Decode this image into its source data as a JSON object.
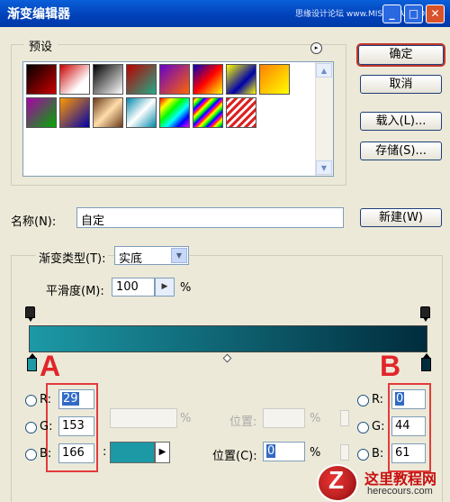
{
  "window": {
    "title": "渐变编辑器",
    "watermark": "思缘设计论坛 www.MISSYUAN.COM",
    "minimize": "_",
    "maximize": "□",
    "close": "✕"
  },
  "presets": {
    "label": "预设",
    "menu_icon": "▸",
    "swatches": [
      {
        "bg": "linear-gradient(135deg,#000 0%,#c00 100%)"
      },
      {
        "bg": "linear-gradient(135deg,#c00 0%,#fff 70%)"
      },
      {
        "bg": "linear-gradient(135deg,#000 0%,#fff 100%)"
      },
      {
        "bg": "linear-gradient(135deg,#b00 0%,#2a8 100%)"
      },
      {
        "bg": "linear-gradient(135deg,#60c 0%,#f60 100%)"
      },
      {
        "bg": "linear-gradient(135deg,#00b 0%,#f00 50%,#ff0 100%)"
      },
      {
        "bg": "linear-gradient(135deg,#ff0 0%,#00a 60%,#ff0 100%)"
      },
      {
        "bg": "linear-gradient(135deg,#ff8000 0%,#ff0 100%)"
      },
      {
        "bg": "linear-gradient(135deg,#a0a 0%,#0a0 100%)"
      },
      {
        "bg": "linear-gradient(135deg,#f90 0%,#00a 100%)"
      },
      {
        "bg": "linear-gradient(135deg,#6a3a1a 0%,#fda 50%,#6a3a1a 100%)"
      },
      {
        "bg": "linear-gradient(135deg,#08a 0%,#fff 50%,#08a 100%)"
      },
      {
        "bg": "linear-gradient(135deg,#f00,#ff0,#0f0,#0ff,#00f,#f0f)"
      },
      {
        "bg": "repeating-linear-gradient(135deg,#f00 0,#ff0 3px,#0f0 6px,#00f 9px,#f0f 12px)"
      },
      {
        "bg": "repeating-linear-gradient(135deg,#d22 0,#d22 3px,#fff 3px,#fff 6px)"
      }
    ],
    "scroll_up": "▲",
    "scroll_down": "▼"
  },
  "buttons": {
    "ok": "确定",
    "cancel": "取消",
    "load": "载入(L)...",
    "save": "存储(S)...",
    "new": "新建(W)"
  },
  "name": {
    "label": "名称(N):",
    "value": "自定"
  },
  "gradient": {
    "type_label": "渐变类型(T):",
    "type_value": "实底",
    "type_arrow": "▼",
    "smoothness_label": "平滑度(M):",
    "smoothness_value": "100",
    "smoothness_arrow": "▶",
    "smoothness_unit": "%",
    "start_color": "#1d99a6",
    "end_color": "#002c3d"
  },
  "annotations": {
    "a": "A",
    "b": "B"
  },
  "stop_a": {
    "r_label": "R:",
    "r": "29",
    "g_label": "G:",
    "g": "153",
    "b_label": "B:",
    "b": "166"
  },
  "stop_b": {
    "r_label": "R:",
    "r": "0",
    "g_label": "G:",
    "g": "44",
    "b_label": "B:",
    "b": "61"
  },
  "stops": {
    "opacity_unit": "%",
    "opacity_loc_label": "位置:",
    "opacity_loc_unit": "%",
    "color_colon": ":",
    "color_arrow": "▶",
    "color_loc_label": "位置(C):",
    "color_loc_value": "0",
    "color_loc_unit": "%"
  },
  "watermark_logo": {
    "letter": "Z",
    "title": "这里教程网",
    "url": "herecours.com"
  }
}
